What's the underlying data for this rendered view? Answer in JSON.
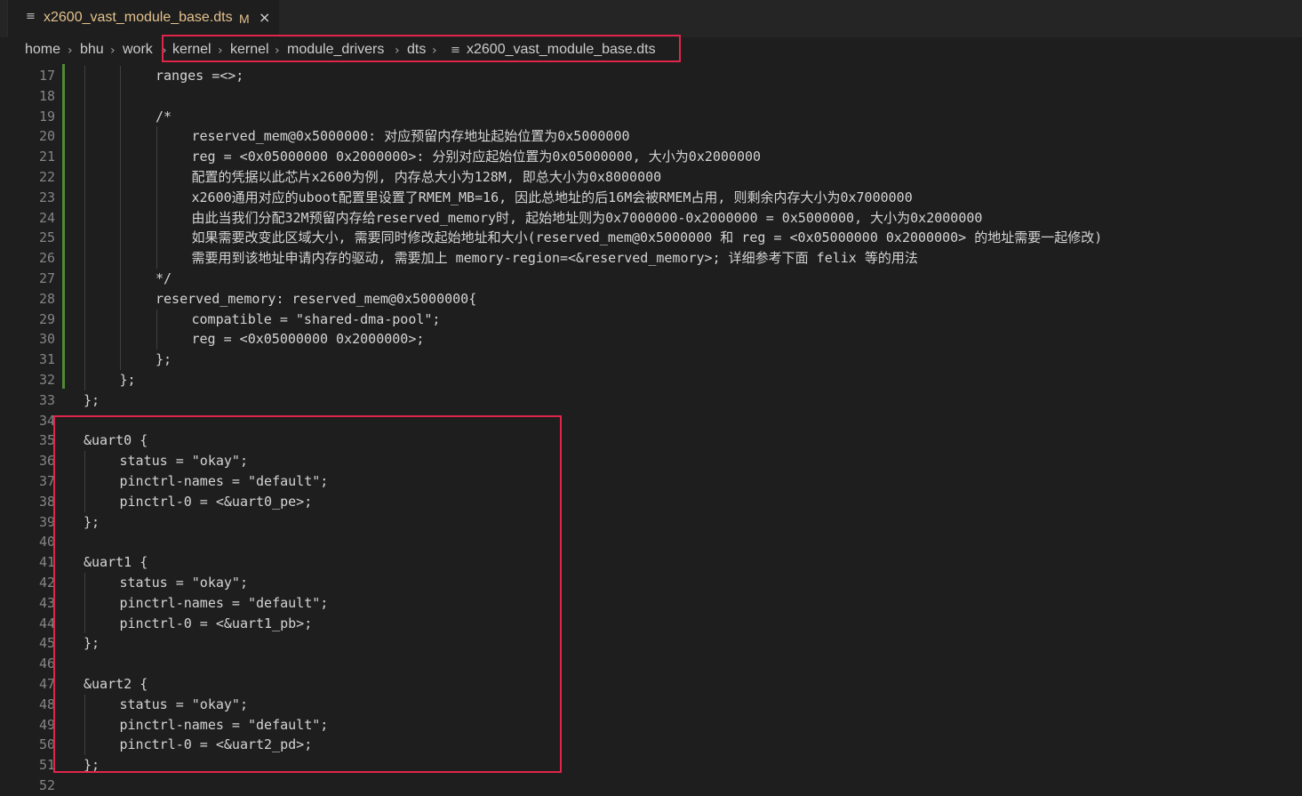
{
  "tab": {
    "icon": "file-lines-icon",
    "filename": "x2600_vast_module_base.dts",
    "modified": "M",
    "close": "×"
  },
  "breadcrumb": [
    "home",
    "bhu",
    "work",
    "kernel",
    "kernel",
    "module_drivers",
    "dts",
    "x2600_vast_module_base.dts"
  ],
  "code_lines": [
    {
      "n": "17",
      "t": "ranges =<>;"
    },
    {
      "n": "18",
      "t": ""
    },
    {
      "n": "19",
      "t": "/*"
    },
    {
      "n": "20",
      "t": "reserved_mem@0x5000000: 对应预留内存地址起始位置为0x5000000"
    },
    {
      "n": "21",
      "t": "reg = <0x05000000 0x2000000>: 分别对应起始位置为0x05000000, 大小为0x2000000"
    },
    {
      "n": "22",
      "t": "配置的凭据以此芯片x2600为例, 内存总大小为128M, 即总大小为0x8000000"
    },
    {
      "n": "23",
      "t": "x2600通用对应的uboot配置里设置了RMEM_MB=16, 因此总地址的后16M会被RMEM占用, 则剩余内存大小为0x7000000"
    },
    {
      "n": "24",
      "t": "由此当我们分配32M预留内存给reserved_memory时, 起始地址则为0x7000000-0x2000000 = 0x5000000, 大小为0x2000000"
    },
    {
      "n": "25",
      "t": "如果需要改变此区域大小, 需要同时修改起始地址和大小(reserved_mem@0x5000000 和 reg = <0x05000000 0x2000000> 的地址需要一起修改)"
    },
    {
      "n": "26",
      "t": "需要用到该地址申请内存的驱动, 需要加上 memory-region=<&reserved_memory>; 详细参考下面 felix 等的用法"
    },
    {
      "n": "27",
      "t": "*/"
    },
    {
      "n": "28",
      "t": "reserved_memory: reserved_mem@0x5000000{"
    },
    {
      "n": "29",
      "t": "compatible = \"shared-dma-pool\";"
    },
    {
      "n": "30",
      "t": "reg = <0x05000000 0x2000000>;"
    },
    {
      "n": "31",
      "t": "};"
    },
    {
      "n": "32",
      "t": "};"
    },
    {
      "n": "33",
      "t": "};"
    },
    {
      "n": "34",
      "t": ""
    },
    {
      "n": "35",
      "t": "&uart0 {"
    },
    {
      "n": "36",
      "t": "status = \"okay\";"
    },
    {
      "n": "37",
      "t": "pinctrl-names = \"default\";"
    },
    {
      "n": "38",
      "t": "pinctrl-0 = <&uart0_pe>;"
    },
    {
      "n": "39",
      "t": "};"
    },
    {
      "n": "40",
      "t": ""
    },
    {
      "n": "41",
      "t": "&uart1 {"
    },
    {
      "n": "42",
      "t": "status = \"okay\";"
    },
    {
      "n": "43",
      "t": "pinctrl-names = \"default\";"
    },
    {
      "n": "44",
      "t": "pinctrl-0 = <&uart1_pb>;"
    },
    {
      "n": "45",
      "t": "};"
    },
    {
      "n": "46",
      "t": ""
    },
    {
      "n": "47",
      "t": "&uart2 {"
    },
    {
      "n": "48",
      "t": "status = \"okay\";"
    },
    {
      "n": "49",
      "t": "pinctrl-names = \"default\";"
    },
    {
      "n": "50",
      "t": "pinctrl-0 = <&uart2_pd>;"
    },
    {
      "n": "51",
      "t": "};"
    },
    {
      "n": "52",
      "t": ""
    }
  ]
}
